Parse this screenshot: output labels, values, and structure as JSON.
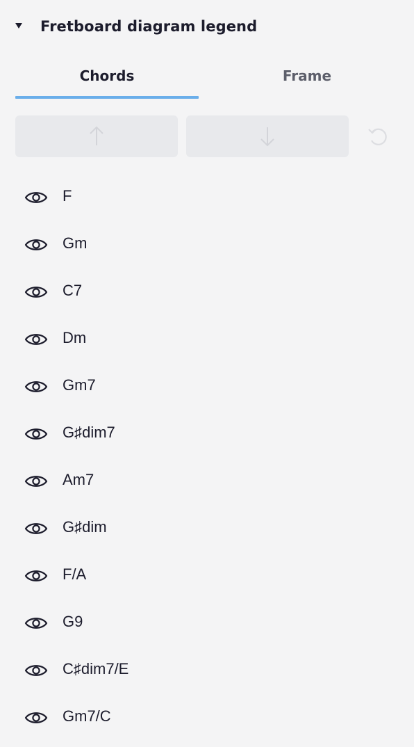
{
  "panel": {
    "title": "Fretboard diagram legend"
  },
  "tabs": [
    {
      "label": "Chords",
      "active": true
    },
    {
      "label": "Frame",
      "active": false
    }
  ],
  "toolbar": {
    "move_up_icon": "arrow-up-icon",
    "move_down_icon": "arrow-down-icon",
    "reset_icon": "undo-icon"
  },
  "chords": [
    {
      "name": "F",
      "visible": true
    },
    {
      "name": "Gm",
      "visible": true
    },
    {
      "name": "C7",
      "visible": true
    },
    {
      "name": "Dm",
      "visible": true
    },
    {
      "name": "Gm7",
      "visible": true
    },
    {
      "name": "G♯dim7",
      "visible": true
    },
    {
      "name": "Am7",
      "visible": true
    },
    {
      "name": "G♯dim",
      "visible": true
    },
    {
      "name": "F/A",
      "visible": true
    },
    {
      "name": "G9",
      "visible": true
    },
    {
      "name": "C♯dim7/E",
      "visible": true
    },
    {
      "name": "Gm7/C",
      "visible": true
    }
  ],
  "colors": {
    "accent": "#6aaeea",
    "background": "#f4f4f5",
    "text": "#1c1c2c",
    "disabled_button": "#e8e9ec"
  }
}
